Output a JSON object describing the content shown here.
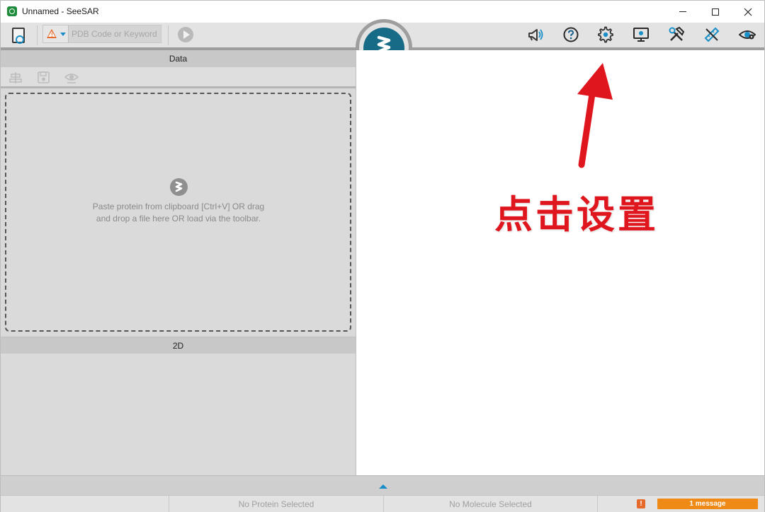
{
  "window": {
    "title": "Unnamed - SeeSAR",
    "app_icon": "seesar-app-icon",
    "controls": [
      "minimize-icon",
      "maximize-icon",
      "close-icon"
    ]
  },
  "toolbar": {
    "search_placeholder": "PDB Code or Keyword",
    "left_icons": [
      "new-document-icon",
      "warning-icon",
      "play-icon"
    ],
    "right_icons": [
      "announcement-icon",
      "help-icon",
      "settings-icon",
      "display-icon",
      "tools-icon",
      "measure-icon",
      "visibility-icon"
    ]
  },
  "left_panel": {
    "data_header": "Data",
    "data_tools": [
      "align-icon",
      "save-icon",
      "view-icon"
    ],
    "drop_text": "Paste protein from clipboard [Ctrl+V] OR drag and drop a file here OR load via the toolbar.",
    "twod_header": "2D"
  },
  "annotation": {
    "text": "点击设置",
    "color": "#e0161e"
  },
  "status": {
    "protein": "No Protein Selected",
    "molecule": "No Molecule Selected",
    "warning_badge": "!",
    "messages": "1 message"
  },
  "colors": {
    "accent": "#1a8fc7",
    "logo": "#176b86",
    "warning": "#e56a2c",
    "message": "#ef8a17"
  }
}
